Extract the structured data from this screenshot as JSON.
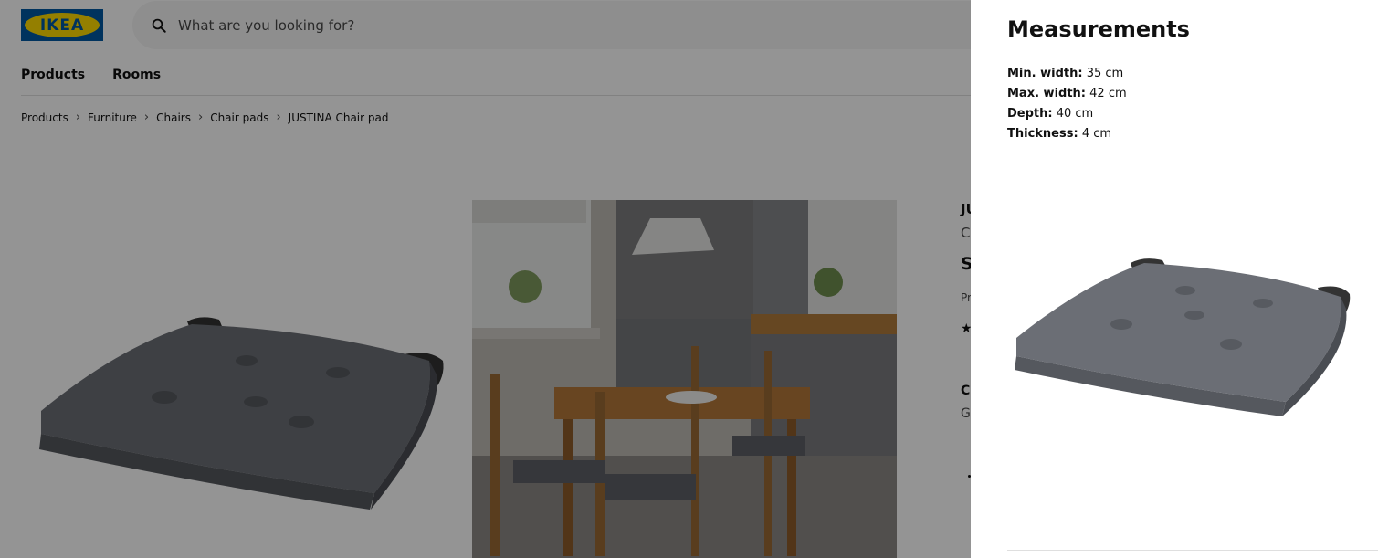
{
  "header": {
    "logo_text": "IKEA",
    "search_placeholder": "What are you looking for?"
  },
  "nav": [
    "Products",
    "Rooms"
  ],
  "breadcrumb": [
    "Products",
    "Furniture",
    "Chairs",
    "Chair pads",
    "JUSTINA Chair pad"
  ],
  "product_info_fragments": {
    "name": "JU",
    "category": "C",
    "price": "S",
    "price_note": "Pr",
    "rating": "★",
    "choose": "Cl",
    "color": "G"
  },
  "panel": {
    "title": "Measurements",
    "measurements": [
      {
        "label": "Min. width:",
        "value": "35 cm"
      },
      {
        "label": "Max. width:",
        "value": "42 cm"
      },
      {
        "label": "Depth:",
        "value": "40 cm"
      },
      {
        "label": "Thickness:",
        "value": "4 cm"
      }
    ]
  },
  "colors": {
    "ikea_blue": "#0058a3",
    "ikea_yellow": "#ffdb00",
    "cushion": "#6b6e75"
  }
}
